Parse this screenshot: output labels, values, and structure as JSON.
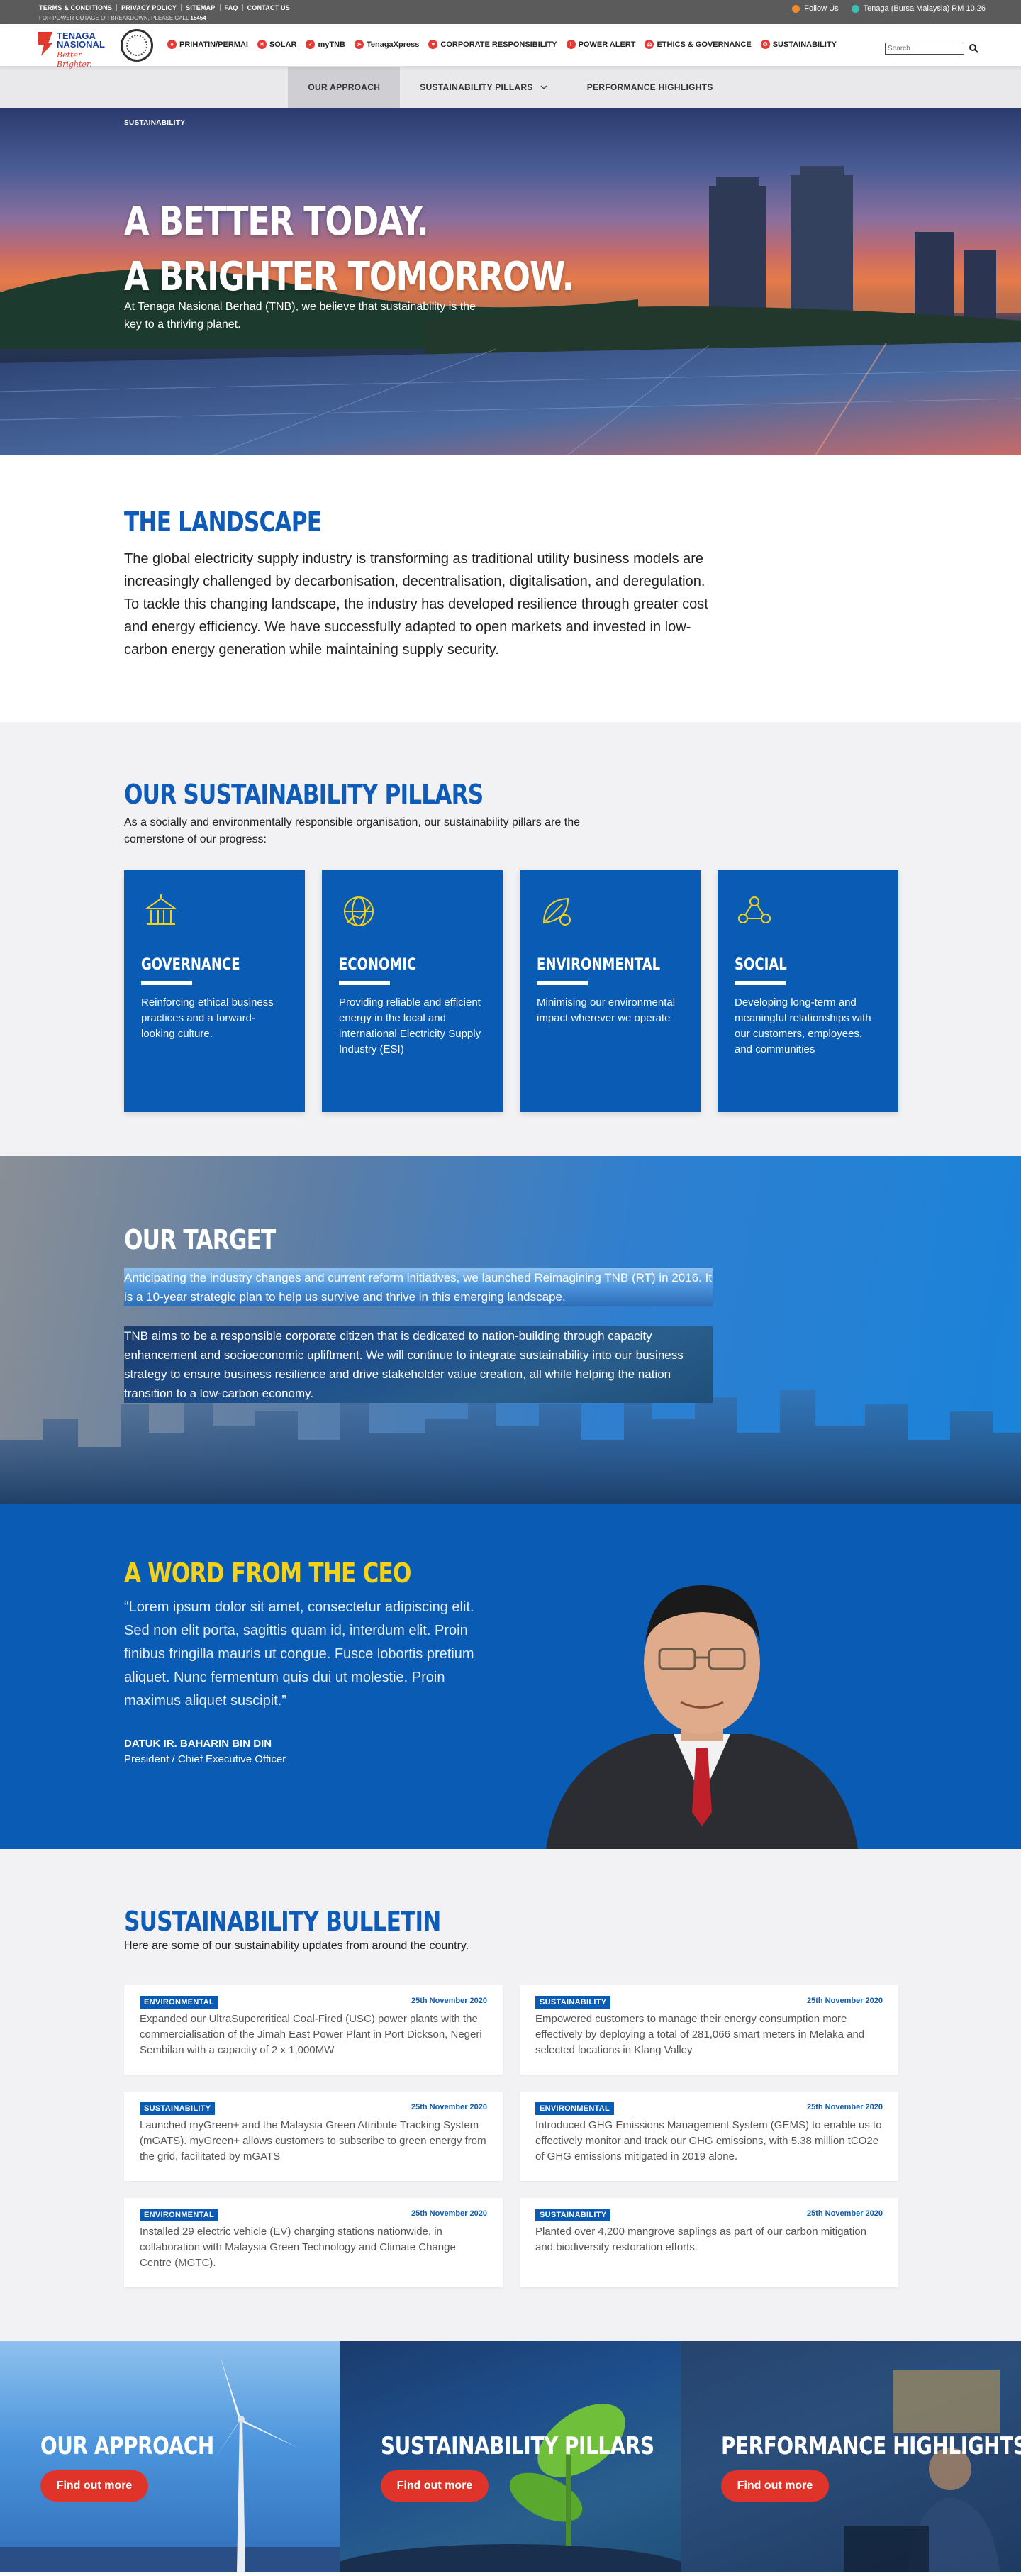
{
  "util_bar": {
    "links": [
      "TERMS & CONDITIONS",
      "PRIVACY POLICY",
      "SITEMAP",
      "FAQ",
      "CONTACT US"
    ],
    "note_prefix": "FOR POWER OUTAGE OR BREAKDOWN, PLEASE CALL",
    "note_number": "15454",
    "follow_us": "Follow Us",
    "stock": "Tenaga (Bursa Malaysia) RM 10.26"
  },
  "nav": {
    "logo_text": "TENAGA NASIONAL",
    "logo_slogan": "Better. Brighter.",
    "items": [
      "PRIHATIN/PERMAI",
      "SOLAR",
      "myTNB",
      "TenagaXpress",
      "CORPORATE RESPONSIBILITY",
      "POWER ALERT",
      "ETHICS & GOVERNANCE",
      "SUSTAINABILITY"
    ],
    "search_placeholder": "Search"
  },
  "sub_nav": {
    "tabs": [
      "OUR APPROACH",
      "SUSTAINABILITY PILLARS",
      "PERFORMANCE HIGHLIGHTS"
    ]
  },
  "hero": {
    "breadcrumb": "SUSTAINABILITY",
    "title_line1": "A BETTER TODAY.",
    "title_line2": "A BRIGHTER TOMORROW.",
    "subtitle": "At Tenaga Nasional Berhad (TNB), we believe that sustainability is the key to a thriving planet."
  },
  "landscape": {
    "title": "THE LANDSCAPE",
    "body": "The global electricity supply industry is transforming as traditional utility business models are increasingly challenged by decarbonisation, decentralisation, digitalisation, and deregulation. To tackle this changing landscape, the industry has developed resilience through greater cost and energy efficiency. We have successfully adapted to open markets and invested in low-carbon energy generation while maintaining supply security."
  },
  "pillars": {
    "title": "OUR SUSTAINABILITY PILLARS",
    "intro": "As a socially and environmentally responsible organisation, our sustainability pillars are the cornerstone of our progress:",
    "cards": [
      {
        "icon": "governance-building-icon",
        "title": "GOVERNANCE",
        "text": "Reinforcing ethical business practices and a forward-looking culture."
      },
      {
        "icon": "economic-globe-chart-icon",
        "title": "ECONOMIC",
        "text": "Providing reliable and efficient energy in the local and international Electricity Supply Industry (ESI)"
      },
      {
        "icon": "environmental-leaf-icon",
        "title": "ENVIRONMENTAL",
        "text": "Minimising our environmental impact wherever we operate"
      },
      {
        "icon": "social-people-network-icon",
        "title": "SOCIAL",
        "text": "Developing long-term and meaningful relationships with our customers, employees, and communities"
      }
    ]
  },
  "target": {
    "title": "OUR TARGET",
    "p1": "Anticipating the industry changes and current reform initiatives, we launched Reimagining TNB (RT) in 2016. It is a 10-year strategic plan to help us survive and thrive in this emerging landscape.",
    "p2": "TNB aims to be a responsible corporate citizen that is dedicated to nation-building through capacity enhancement and socioeconomic upliftment. We will continue to integrate sustainability into our business strategy to ensure business resilience and drive stakeholder value creation, all while helping the nation transition to a low-carbon economy."
  },
  "ceo": {
    "title": "A WORD FROM THE CEO",
    "quote": "“Lorem ipsum dolor sit amet, consectetur adipiscing elit. Sed non elit porta, sagittis quam id, interdum elit. Proin finibus fringilla mauris ut congue. Fusce lobortis pretium aliquet. Nunc fermentum quis dui ut molestie. Proin maximus aliquet suscipit.”",
    "name": "DATUK IR. BAHARIN BIN DIN",
    "role": "President / Chief Executive Officer"
  },
  "bulletin": {
    "title": "SUSTAINABILITY BULLETIN",
    "intro": "Here are some of our sustainability updates from around the country.",
    "items": [
      {
        "tag": "ENVIRONMENTAL",
        "date": "25th November 2020",
        "text": "Expanded our UltraSupercritical Coal-Fired (USC) power plants with the commercialisation of the Jimah East Power Plant in Port Dickson, Negeri Sembilan with a capacity of 2 x 1,000MW"
      },
      {
        "tag": "SUSTAINABILITY",
        "date": "25th November 2020",
        "text": "Empowered customers to manage their energy consumption more effectively by deploying a total of 281,066 smart meters in Melaka and selected locations in Klang Valley"
      },
      {
        "tag": "SUSTAINABILITY",
        "date": "25th November 2020",
        "text": "Launched myGreen+ and the Malaysia Green Attribute Tracking System (mGATS). myGreen+ allows customers to subscribe to green energy from the grid, facilitated by mGATS"
      },
      {
        "tag": "ENVIRONMENTAL",
        "date": "25th November 2020",
        "text": "Introduced GHG Emissions Management System (GEMS) to enable us to effectively monitor and track our GHG emissions, with 5.38 million tCO2e of GHG emissions mitigated in 2019 alone."
      },
      {
        "tag": "ENVIRONMENTAL",
        "date": "25th November 2020",
        "text": "Installed 29 electric vehicle (EV) charging stations nationwide, in collaboration with Malaysia Green Technology and Climate Change Centre (MGTC)."
      },
      {
        "tag": "SUSTAINABILITY",
        "date": "25th November 2020",
        "text": "Planted over 4,200 mangrove saplings as part of our carbon mitigation and biodiversity restoration efforts."
      }
    ]
  },
  "cta": {
    "panels": [
      {
        "title": "OUR APPROACH",
        "button": "Find out more"
      },
      {
        "title": "SUSTAINABILITY PILLARS",
        "button": "Find out more"
      },
      {
        "title": "PERFORMANCE HIGHLIGHTS",
        "button": "Find out more"
      }
    ]
  },
  "colors": {
    "brand_blue": "#0a5bb3",
    "title_blue": "#0f5cb8",
    "ceo_yellow": "#f5d21a",
    "cta_red": "#e0342b",
    "nav_icon_red": "#e53a35"
  }
}
